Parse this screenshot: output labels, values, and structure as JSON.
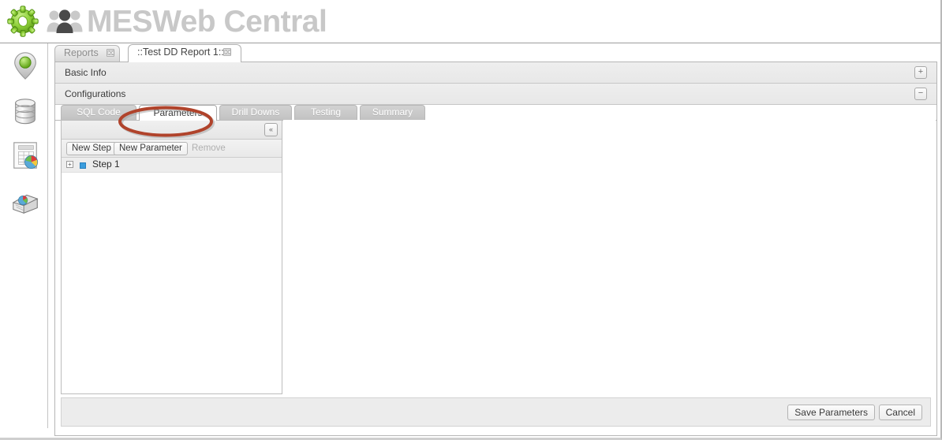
{
  "app": {
    "title": "MESWeb Central",
    "gear_icon": "gear-icon",
    "people_icon": "people-group-icon"
  },
  "sidebar": {
    "items": [
      {
        "name": "location-pin-icon",
        "label": "Location"
      },
      {
        "name": "database-icon",
        "label": "Database"
      },
      {
        "name": "report-chart-icon",
        "label": "Report"
      },
      {
        "name": "report-stack-icon",
        "label": "Report Stack"
      }
    ]
  },
  "top_tabs": [
    {
      "label": "Reports",
      "active": false,
      "close": "⌧"
    },
    {
      "label": "::Test DD Report 1::",
      "active": true,
      "close": "⌧"
    }
  ],
  "sections": [
    {
      "label": "Basic Info",
      "tool": "+",
      "tool_name": "expand-button"
    },
    {
      "label": "Configurations",
      "tool": "−",
      "tool_name": "collapse-button"
    }
  ],
  "inner_tabs": [
    {
      "label": "SQL Code",
      "active": false
    },
    {
      "label": "Parameters",
      "active": true
    },
    {
      "label": "Drill Downs",
      "active": false
    },
    {
      "label": "Testing",
      "active": false
    },
    {
      "label": "Summary",
      "active": false
    }
  ],
  "tree_panel": {
    "collapse_label": "«",
    "toolbar": [
      {
        "label": "New Step",
        "disabled": false
      },
      {
        "label": "New Parameter",
        "disabled": false
      },
      {
        "label": "Remove",
        "disabled": true
      }
    ],
    "rows": [
      {
        "label": "Step 1",
        "expander": "+",
        "selected": true
      }
    ]
  },
  "footer": {
    "save_label": "Save Parameters",
    "cancel_label": "Cancel"
  },
  "annotation": {
    "target": "Parameters",
    "color": "#b0432b"
  }
}
